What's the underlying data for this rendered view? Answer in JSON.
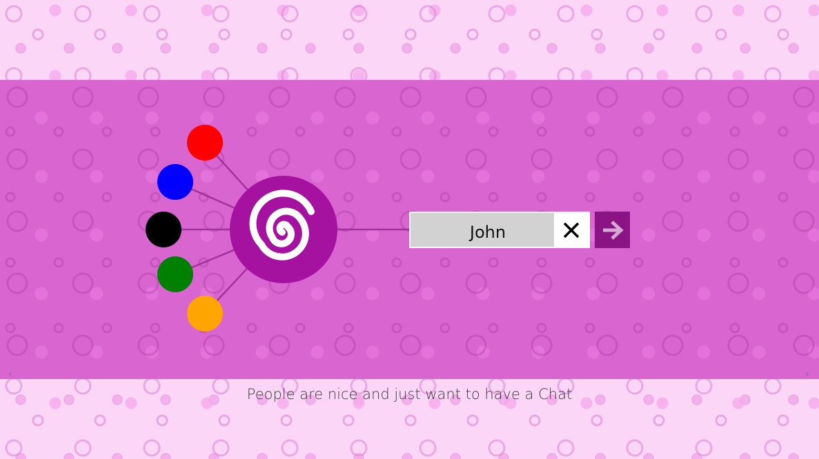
{
  "login": {
    "name_value": "John",
    "tagline": "People are nice and just want to have a Chat"
  },
  "icons": {
    "clear": "close-icon",
    "submit": "arrow-right-icon",
    "logo": "spiral-icon"
  },
  "colors": {
    "band": "#d865d0",
    "logo_purple": "#a512a0",
    "submit_purple": "#8b1485",
    "nodes": [
      "#ff0000",
      "#0000ff",
      "#000000",
      "#008000",
      "#ffa500"
    ]
  }
}
